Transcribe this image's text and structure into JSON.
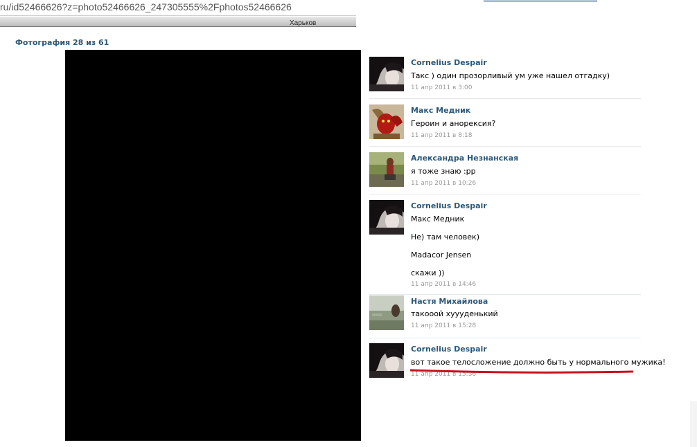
{
  "browser": {
    "url": "ru/id52466626?z=photo52466626_247305555%2Fphotos52466626"
  },
  "topbar": {
    "city": "Харьков"
  },
  "photo": {
    "counter": "Фотография 28 из 61"
  },
  "comments": [
    {
      "author": "Cornelius Despair",
      "lines": [
        "Такс ) один прозорливый ум уже нашел отгадку)"
      ],
      "date": "11 апр 2011 в 3:00",
      "avatar": "dark-haired-person-avatar"
    },
    {
      "author": "Макс Медник",
      "lines": [
        "Героин и анорексия?"
      ],
      "date": "11 апр 2011 в 8:18",
      "avatar": "red-devil-avatar"
    },
    {
      "author": "Александра Незнанская",
      "lines": [
        "я тоже знаю :pp"
      ],
      "date": "11 апр 2011 в 10:26",
      "avatar": "outdoor-girl-avatar"
    },
    {
      "author": "Cornelius Despair",
      "lines": [
        "Макс Медник",
        "Не) там человек)",
        "Madacor Jensen",
        "скажи ))"
      ],
      "date": "11 апр 2011 в 14:46",
      "avatar": "dark-haired-person-avatar"
    },
    {
      "author": "Настя Михайлова",
      "lines": [
        "такооой хуууденький"
      ],
      "date": "11 апр 2011 в 15:28",
      "avatar": "landscape-avatar"
    },
    {
      "author": "Cornelius Despair",
      "lines": [
        "вот такое телосложение должно быть у нормального мужика!"
      ],
      "date": "11 апр 2011 в 15:36",
      "avatar": "dark-haired-person-avatar"
    }
  ],
  "colors": {
    "link": "#2b587a",
    "date": "#999999",
    "highlight": "#c8101e"
  }
}
